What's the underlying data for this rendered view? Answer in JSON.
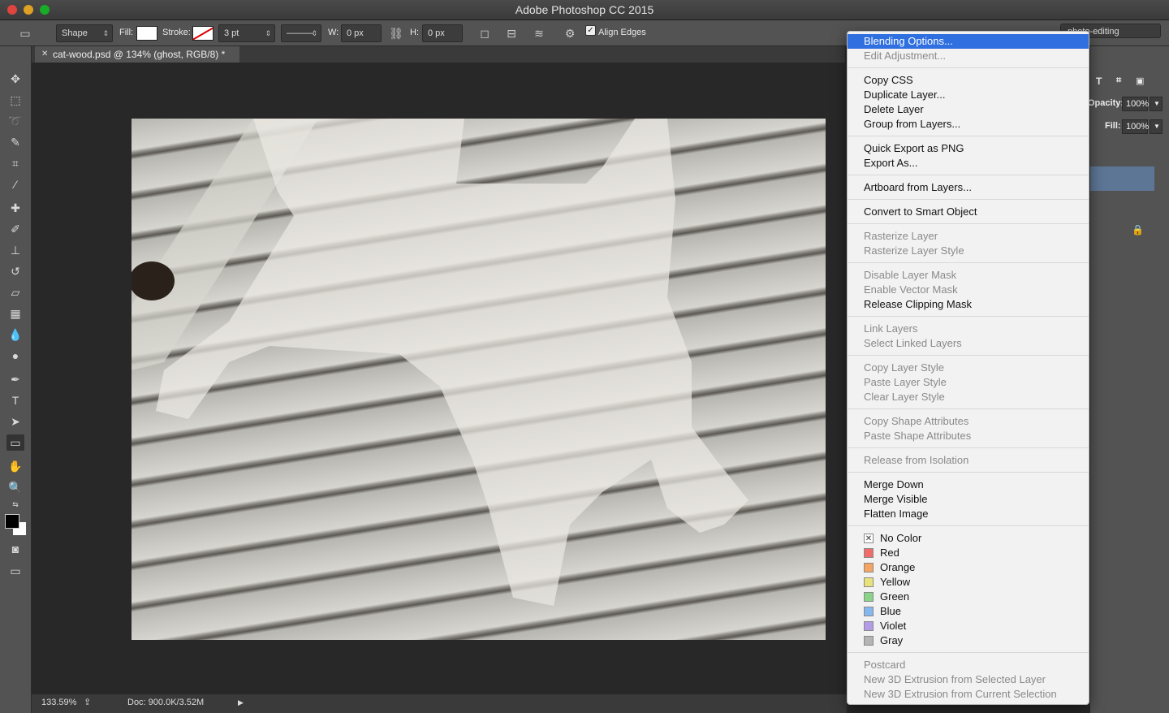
{
  "window": {
    "title": "Adobe Photoshop CC 2015"
  },
  "options_bar": {
    "shape_mode": "Shape",
    "fill_label": "Fill:",
    "stroke_label": "Stroke:",
    "stroke_width": "3 pt",
    "w_label": "W:",
    "w_value": "0 px",
    "h_label": "H:",
    "h_value": "0 px",
    "align_edges_label": "Align Edges",
    "align_edges_checked": true,
    "workspace": "photo-editing"
  },
  "document": {
    "tab_title": "cat-wood.psd @ 134% (ghost, RGB/8) *",
    "zoom": "133.59%",
    "doc_info": "Doc: 900.0K/3.52M"
  },
  "layers_panel": {
    "opacity_label": "Opacity:",
    "opacity_value": "100%",
    "fill_label": "Fill:",
    "fill_value": "100%"
  },
  "context_menu": {
    "groups": [
      [
        {
          "label": "Blending Options...",
          "state": "highlight"
        },
        {
          "label": "Edit Adjustment...",
          "state": "disabled"
        }
      ],
      [
        {
          "label": "Copy CSS",
          "state": "enabled"
        },
        {
          "label": "Duplicate Layer...",
          "state": "enabled"
        },
        {
          "label": "Delete Layer",
          "state": "enabled"
        },
        {
          "label": "Group from Layers...",
          "state": "enabled"
        }
      ],
      [
        {
          "label": "Quick Export as PNG",
          "state": "enabled"
        },
        {
          "label": "Export As...",
          "state": "enabled"
        }
      ],
      [
        {
          "label": "Artboard from Layers...",
          "state": "enabled"
        }
      ],
      [
        {
          "label": "Convert to Smart Object",
          "state": "enabled"
        }
      ],
      [
        {
          "label": "Rasterize Layer",
          "state": "disabled"
        },
        {
          "label": "Rasterize Layer Style",
          "state": "disabled"
        }
      ],
      [
        {
          "label": "Disable Layer Mask",
          "state": "disabled"
        },
        {
          "label": "Enable Vector Mask",
          "state": "disabled"
        },
        {
          "label": "Release Clipping Mask",
          "state": "enabled"
        }
      ],
      [
        {
          "label": "Link Layers",
          "state": "disabled"
        },
        {
          "label": "Select Linked Layers",
          "state": "disabled"
        }
      ],
      [
        {
          "label": "Copy Layer Style",
          "state": "disabled"
        },
        {
          "label": "Paste Layer Style",
          "state": "disabled"
        },
        {
          "label": "Clear Layer Style",
          "state": "disabled"
        }
      ],
      [
        {
          "label": "Copy Shape Attributes",
          "state": "disabled"
        },
        {
          "label": "Paste Shape Attributes",
          "state": "disabled"
        }
      ],
      [
        {
          "label": "Release from Isolation",
          "state": "disabled"
        }
      ],
      [
        {
          "label": "Merge Down",
          "state": "enabled"
        },
        {
          "label": "Merge Visible",
          "state": "enabled"
        },
        {
          "label": "Flatten Image",
          "state": "enabled"
        }
      ],
      [
        {
          "label": "No Color",
          "state": "enabled",
          "color": "none"
        },
        {
          "label": "Red",
          "state": "enabled",
          "color": "#f26b6b"
        },
        {
          "label": "Orange",
          "state": "enabled",
          "color": "#f5a462"
        },
        {
          "label": "Yellow",
          "state": "enabled",
          "color": "#e8e27a"
        },
        {
          "label": "Green",
          "state": "enabled",
          "color": "#8ad48a"
        },
        {
          "label": "Blue",
          "state": "enabled",
          "color": "#86b8f0"
        },
        {
          "label": "Violet",
          "state": "enabled",
          "color": "#b49be8"
        },
        {
          "label": "Gray",
          "state": "enabled",
          "color": "#b4b4b4"
        }
      ],
      [
        {
          "label": "Postcard",
          "state": "disabled"
        },
        {
          "label": "New 3D Extrusion from Selected Layer",
          "state": "disabled"
        },
        {
          "label": "New 3D Extrusion from Current Selection",
          "state": "disabled"
        }
      ]
    ]
  }
}
